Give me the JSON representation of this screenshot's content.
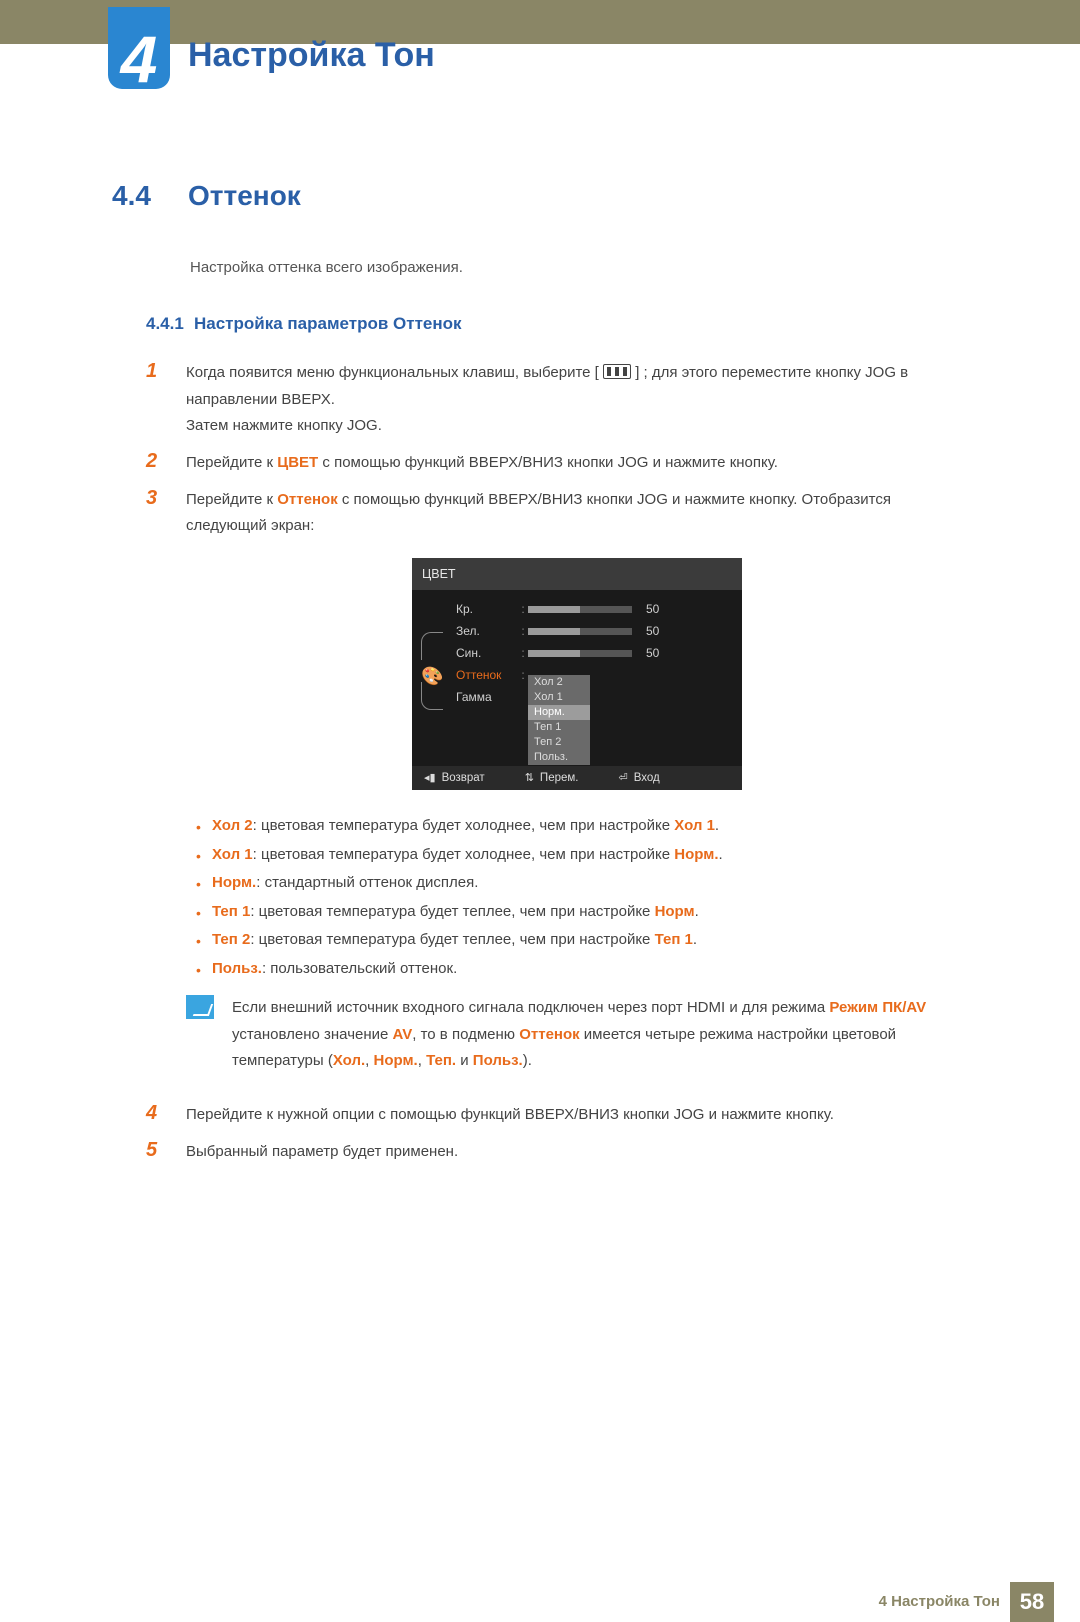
{
  "chapter": {
    "number": "4",
    "title": "Настройка Тон"
  },
  "section": {
    "number": "4.4",
    "title": "Оттенок"
  },
  "intro": "Настройка оттенка всего изображения.",
  "subsection": {
    "number": "4.4.1",
    "title": "Настройка параметров Оттенок"
  },
  "steps": {
    "s1_a": "Когда появится меню функциональных клавиш, выберите [",
    "s1_b": "] ; для этого переместите кнопку JOG в направлении ВВЕРХ.",
    "s1_c": "Затем нажмите кнопку JOG.",
    "s2_a": "Перейдите к ",
    "s2_kw": "ЦВЕТ",
    "s2_b": " с помощью функций ВВЕРХ/ВНИЗ кнопки JOG и нажмите кнопку.",
    "s3_a": "Перейдите к ",
    "s3_kw": "Оттенок",
    "s3_b": " с помощью функций ВВЕРХ/ВНИЗ кнопки JOG и нажмите кнопку. Отобразится следующий экран:",
    "s4": "Перейдите к нужной опции с помощью функций ВВЕРХ/ВНИЗ кнопки JOG и нажмите кнопку.",
    "s5": "Выбранный параметр будет применен."
  },
  "osd": {
    "title": "ЦВЕТ",
    "items": [
      {
        "label": "Кр.",
        "value": "50"
      },
      {
        "label": "Зел.",
        "value": "50"
      },
      {
        "label": "Син.",
        "value": "50"
      }
    ],
    "tone_label": "Оттенок",
    "gamma_label": "Гамма",
    "dropdown": [
      "Хол 2",
      "Хол 1",
      "Норм.",
      "Теп 1",
      "Теп 2",
      "Польз."
    ],
    "selected": "Норм.",
    "footer": {
      "back": "Возврат",
      "move": "Перем.",
      "enter": "Вход"
    }
  },
  "bullets": {
    "b1_kw": "Хол 2",
    "b1_t": ": цветовая температура будет холоднее, чем при настройке ",
    "b1_ref": "Хол 1",
    "b1_end": ".",
    "b2_kw": "Хол 1",
    "b2_t": ": цветовая температура будет холоднее, чем при настройке ",
    "b2_ref": "Норм.",
    "b2_end": ".",
    "b3_kw": "Норм.",
    "b3_t": ": стандартный оттенок дисплея.",
    "b4_kw": "Теп 1",
    "b4_t": ": цветовая температура будет теплее, чем при настройке ",
    "b4_ref": "Норм",
    "b4_end": ".",
    "b5_kw": "Теп 2",
    "b5_t": ": цветовая температура будет теплее, чем при настройке ",
    "b5_ref": "Теп 1",
    "b5_end": ".",
    "b6_kw": "Польз.",
    "b6_t": ": пользовательский оттенок."
  },
  "note": {
    "a": "Если внешний источник входного сигнала подключен через порт HDMI и для режима ",
    "kw1": "Режим ПК/AV",
    "b": " установлено значение ",
    "kw2": "AV",
    "c": ", то в подменю ",
    "kw3": "Оттенок",
    "d": " имеется четыре режима настройки цветовой температуры (",
    "m1": "Хол.",
    "sep1": ", ",
    "m2": "Норм.",
    "sep2": ", ",
    "m3": "Теп.",
    "sep3": " и ",
    "m4": "Польз.",
    "e": ")."
  },
  "footer": {
    "text": "4 Настройка Тон",
    "page": "58"
  }
}
